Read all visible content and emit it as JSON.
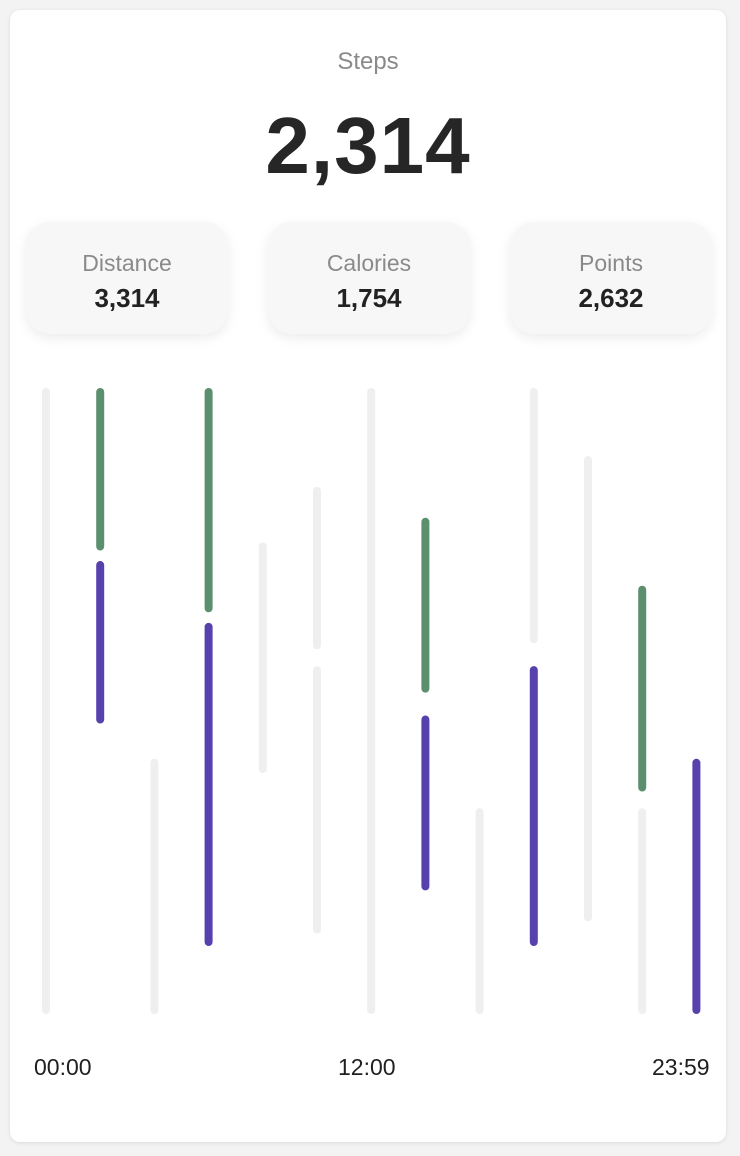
{
  "header": {
    "label": "Steps",
    "value": "2,314"
  },
  "stats": [
    {
      "label": "Distance",
      "value": "3,314"
    },
    {
      "label": "Calories",
      "value": "1,754"
    },
    {
      "label": "Points",
      "value": "2,632"
    }
  ],
  "colors": {
    "green": "#5b8f6e",
    "purple": "#5641ad",
    "track": "#efefef"
  },
  "chart_data": {
    "type": "bar",
    "x_ticks": [
      "00:00",
      "12:00",
      "23:59"
    ],
    "ylim": [
      0,
      100
    ],
    "bars": [
      {
        "index": 0,
        "track": [
          0,
          100
        ]
      },
      {
        "index": 1,
        "green": [
          75,
          100
        ],
        "purple": [
          47,
          72
        ]
      },
      {
        "index": 2,
        "track": [
          0,
          40
        ]
      },
      {
        "index": 3,
        "green": [
          65,
          100
        ],
        "purple": [
          11,
          62
        ]
      },
      {
        "index": 4,
        "track": [
          39,
          75
        ]
      },
      {
        "index": 5,
        "track": [
          59,
          84
        ],
        "track2": [
          13,
          55
        ]
      },
      {
        "index": 6,
        "track": [
          0,
          100
        ]
      },
      {
        "index": 7,
        "green": [
          52,
          79
        ],
        "purple": [
          20,
          47
        ]
      },
      {
        "index": 8,
        "track": [
          0,
          32
        ]
      },
      {
        "index": 9,
        "track": [
          60,
          100
        ],
        "purple": [
          11,
          55
        ]
      },
      {
        "index": 10,
        "track": [
          15,
          89
        ]
      },
      {
        "index": 11,
        "green": [
          36,
          68
        ],
        "track": [
          0,
          32
        ]
      },
      {
        "index": 12,
        "purple": [
          0,
          40
        ]
      }
    ]
  }
}
